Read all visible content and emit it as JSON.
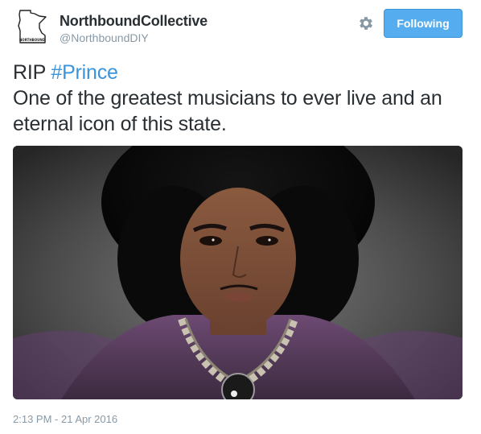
{
  "user": {
    "display_name": "NorthboundCollective",
    "screen_name": "@NorthboundDIY",
    "avatar_icon": "minnesota-state-logo-icon",
    "avatar_logo_text": "NORTHBOUND"
  },
  "actions": {
    "settings_icon": "gear-icon",
    "follow_label": "Following",
    "follow_color": "#55acee"
  },
  "tweet": {
    "text_prefix": "RIP ",
    "hashtag": "#Prince",
    "text_body": "One of the greatest musicians to ever live and an eternal icon of this state.",
    "hashtag_color": "#3b94d9"
  },
  "media": {
    "type": "photo"
  },
  "meta": {
    "timestamp": "2:13 PM - 21 Apr 2016"
  }
}
